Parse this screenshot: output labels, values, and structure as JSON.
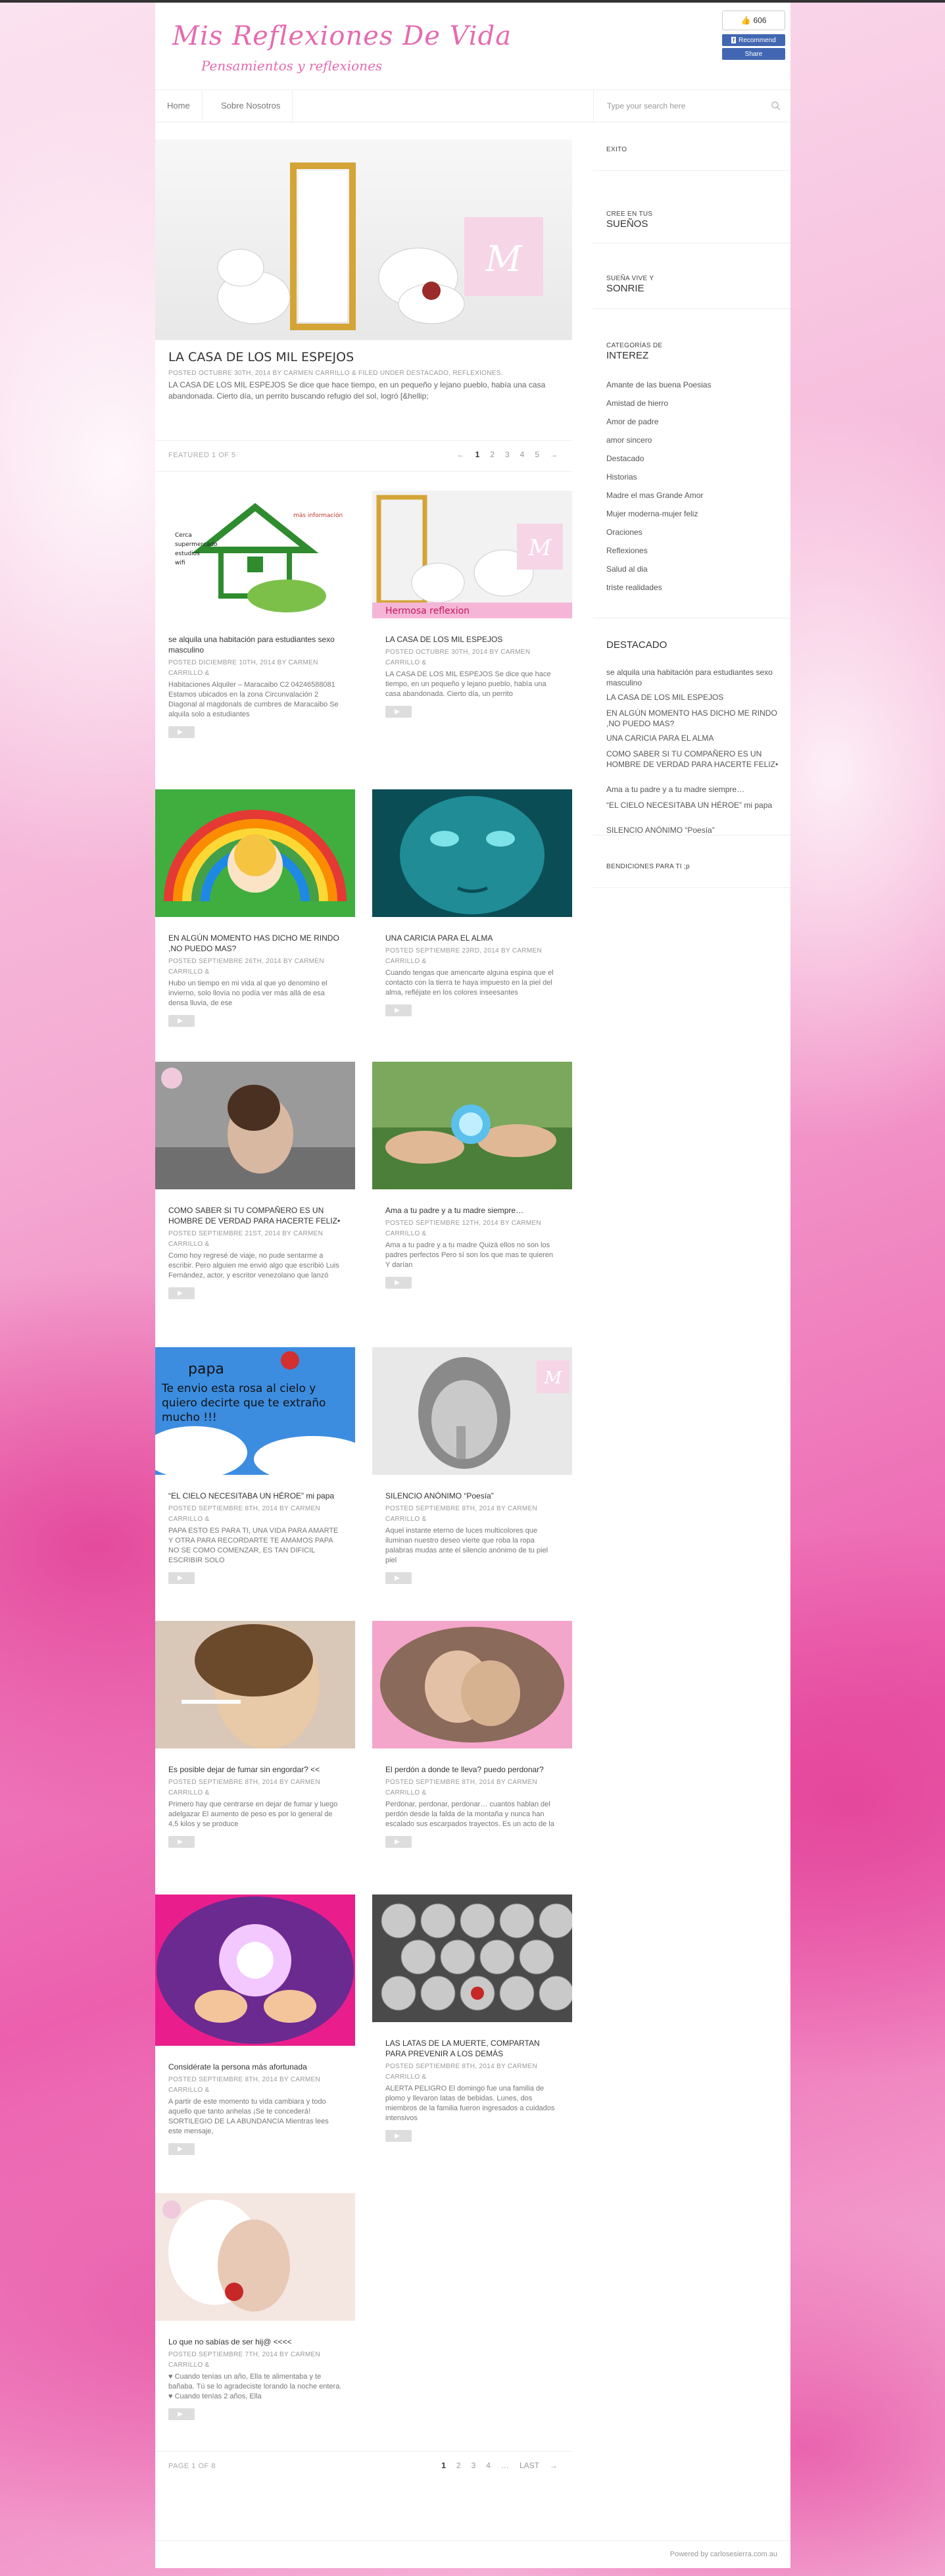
{
  "site": {
    "title": "Mis Reflexiones De Vida",
    "tagline": "Pensamientos y reflexiones"
  },
  "social": {
    "like_count": "606",
    "recommend_label": "Recommend",
    "share_label": "Share"
  },
  "nav": {
    "items": [
      "Home",
      "Sobre Nosotros"
    ]
  },
  "search": {
    "placeholder": "Type your search here"
  },
  "hero": {
    "title": "LA CASA DE LOS MIL ESPEJOS",
    "meta": "POSTED OCTUBRE 30TH, 2014 BY CARMEN CARRILLO & FILED UNDER DESTACADO, REFLEXIONES.",
    "excerpt": "LA CASA DE LOS MIL ESPEJOS Se dice que hace tiempo, en un pequeño y lejano pueblo, había una casa abandonada. Cierto día, un perrito buscando refugio del sol, logró [&hellip;"
  },
  "featured_pager": {
    "label": "FEATURED 1 OF 5",
    "prev": "←",
    "pages": [
      "1",
      "2",
      "3",
      "4",
      "5"
    ],
    "next": "→"
  },
  "posts": [
    {
      "title": "se alquila una habitación para estudiantes sexo masculino",
      "meta": "POSTED DICIEMBRE 10TH, 2014 BY CARMEN CARRILLO &",
      "excerpt": "Habitaciones Alquiler – Maracaibo C2 04246588081 Estamos ubicados en la zona Circunvalación 2 Diagonal al magdonals de cumbres de Maracaibo Se alquila solo a estudiantes",
      "image": "house-ad"
    },
    {
      "title": "LA CASA DE LOS MIL ESPEJOS",
      "meta": "POSTED OCTUBRE 30TH, 2014 BY CARMEN CARRILLO &",
      "excerpt": "LA CASA DE LOS MIL ESPEJOS Se dice que hace tiempo, en un pequeño y lejano pueblo, había una casa abandonada. Cierto día, un perrito",
      "image": "dogs-mirror",
      "caption": "Hermosa reflexion"
    },
    {
      "title": "EN ALGÚN MOMENTO HAS DICHO ME RINDO ,NO PUEDO MAS?",
      "meta": "POSTED SEPTIEMBRE 26TH, 2014 BY CARMEN CARRILLO &",
      "excerpt": "Hubo un tiempo en mi vida al que yo denomino el invierno, solo llovía no podía ver más allá de esa densa lluvia, de ese",
      "image": "rainbow-child"
    },
    {
      "title": "UNA CARICIA PARA EL ALMA",
      "meta": "POSTED SEPTIEMBRE 23RD, 2014 BY CARMEN CARRILLO &",
      "excerpt": "Cuando tengas que amencarte alguna espina que el contacto con la tierra te haya impuesto en la piel del alma, refléjate en los colores inseesantes",
      "image": "teal-face"
    },
    {
      "title": "COMO SABER SI TU COMPAÑERO ES UN HOMBRE DE VERDAD PARA HACERTE FELIZ•",
      "meta": "POSTED SEPTIEMBRE 21ST, 2014 BY CARMEN CARRILLO &",
      "excerpt": "Como hoy regresé de viaje, no pude sentarme a escribir. Pero alguien me envió algo que escribió Luis Fernández, actor, y escritor venezolano que lanzó",
      "image": "sad-girl"
    },
    {
      "title": "Ama a tu padre y a tu madre siempre…",
      "meta": "POSTED SEPTIEMBRE 12TH, 2014 BY CARMEN CARRILLO &",
      "excerpt": "Ama a tu padre y a tu madre Quizá ellos no son los padres perfectos Pero sí son los que mas te quieren Y darían",
      "image": "hands-globe"
    },
    {
      "title": "“EL CIELO NECESITABA UN HÉROE” mi papa",
      "meta": "POSTED SEPTIEMBRE 8TH, 2014 BY CARMEN CARRILLO &",
      "excerpt": "PAPA ESTO ES PARA TI, UNA VIDA PARA AMARTE Y OTRA PARA RECORDARTE TE AMAMOS PAPA NO SE COMO COMENZAR, ES TAN DIFICIL ESCRIBIR SOLO",
      "image": "sky-papa",
      "overlay": [
        "papa",
        "Te envio esta rosa al cielo y",
        "quiero decirte que te extraño",
        "mucho !!!"
      ]
    },
    {
      "title": "SILENCIO ANÓNIMO “Poesía”",
      "meta": "POSTED SEPTIEMBRE 8TH, 2014 BY CARMEN CARRILLO &",
      "excerpt": "Aquel instante eterno de luces multicolores que iluminan nuestro deseo vierte que roba la ropa palabras mudas ante el silencio anónimo de tu piel piel",
      "image": "child-shh"
    },
    {
      "title": "Es posible dejar de fumar sin engordar? <<",
      "meta": "POSTED SEPTIEMBRE 8TH, 2014 BY CARMEN CARRILLO &",
      "excerpt": "Primero hay que centrarse en dejar de fumar y luego adelgazar El aumento de peso es por lo general de 4,5 kilos y se produce",
      "image": "smoker"
    },
    {
      "title": "El perdón a donde te lleva? puedo perdonar?",
      "meta": "POSTED SEPTIEMBRE 8TH, 2014 BY CARMEN CARRILLO &",
      "excerpt": "Perdonar, perdonar, perdonar… cuantos hablan del perdón desde la falda de la montaña y nunca han escalado sus escarpados trayectos. Es un acto de la",
      "image": "hug"
    },
    {
      "title": "Considérate la persona más afortunada",
      "meta": "POSTED SEPTIEMBRE 8TH, 2014 BY CARMEN CARRILLO &",
      "excerpt": "A partir de este momento tu vida cambiara y todo aquello que tanto anhelas ¡Se te concederá! SORTILEGIO DE LA ABUNDANCIA Mientras lees este mensaje,",
      "image": "glow-hands"
    },
    {
      "title": "LAS LATAS DE LA MUERTE, COMPARTAN PARA PREVENIR A LOS DEMÁS",
      "meta": "POSTED SEPTIEMBRE 8TH, 2014 BY CARMEN CARRILLO &",
      "excerpt": "ALERTA PELIGRO El domingo fue una familia de plomo y llevaron latas de bebidas. Lunes, dos miembros de la familia fueron ingresados a cuidados intensivos",
      "image": "cans"
    },
    {
      "title": "Lo que no sabías de ser hij@ <<<<",
      "meta": "POSTED SEPTIEMBRE 7TH, 2014 BY CARMEN CARRILLO &",
      "excerpt": "♥ Cuando tenías un año, Ella te alimentaba y te bañaba. Tú se lo agradeciste lorando la noche entera. ♥ Cuando tenías 2 años, Ella",
      "image": "angel-rose"
    }
  ],
  "sidebar": {
    "exito": "EXITO",
    "cree_small": "CREE EN TUS",
    "cree_big": "SUEÑOS",
    "sonrie_small": "SUEÑA VIVE Y",
    "sonrie_big": "SONRIE",
    "cat_small": "CATEGORÍAS DE",
    "cat_big": "INTEREZ",
    "categories": [
      "Amante de las buena Poesias",
      "Amistad de hierro",
      "Amor de padre",
      "amor sincero",
      "Destacado",
      "Historias",
      "Madre el mas Grande Amor",
      "Mujer moderna-mujer feliz",
      "Oraciones",
      "Reflexiones",
      "Salud al dia",
      "triste realidades"
    ],
    "destacado_title": "DESTACADO",
    "destacado": [
      "se alquila una habitación para estudiantes sexo masculino",
      "LA CASA DE LOS MIL ESPEJOS",
      "EN ALGÚN MOMENTO HAS DICHO ME RINDO ,NO PUEDO MAS?",
      "UNA CARICIA PARA EL ALMA",
      "COMO SABER SI TU COMPAÑERO ES UN HOMBRE DE VERDAD PARA HACERTE FELIZ•",
      "Ama a tu padre y a tu madre siempre…",
      "“EL CIELO NECESITABA UN HÉROE” mi papa",
      "SILENCIO ANÓNIMO “Poesía”"
    ],
    "bendiciones": "BENDICIONES PARA TI ;p"
  },
  "bottom_pager": {
    "label": "PAGE 1 OF 8",
    "pages": [
      "1",
      "2",
      "3",
      "4",
      "…",
      "LAST",
      "→"
    ]
  },
  "footer": {
    "credit": "Powered by carlosesierra.com.au"
  },
  "colors": {
    "brand_pink": "#e56bb0",
    "facebook_blue": "#4267b2"
  }
}
